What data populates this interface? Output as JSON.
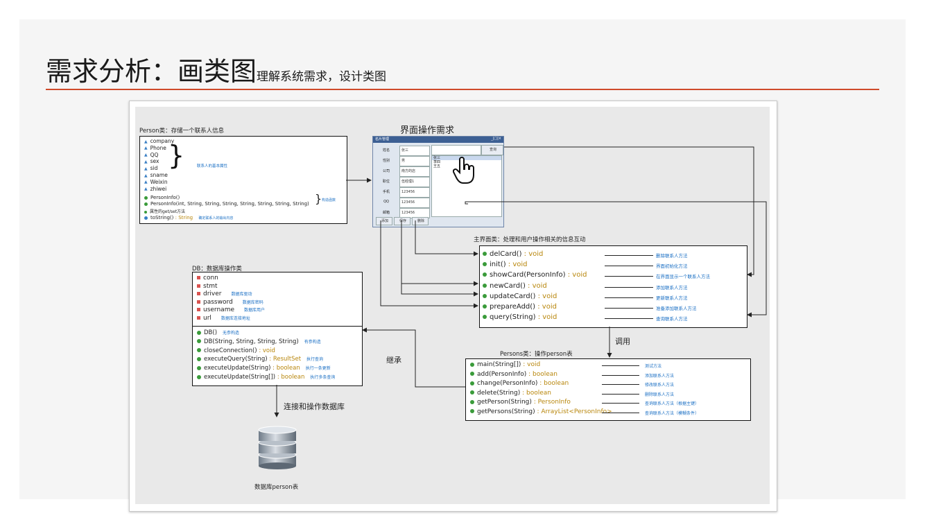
{
  "slide": {
    "title_main": "需求分析：画类图",
    "title_sub": "理解系统需求，设计类图"
  },
  "ui_section_title": "界面操作需求",
  "person_class": {
    "title": "Person类：存储一个联系人信息",
    "attributes": [
      "company",
      "Phone",
      "QQ",
      "sex",
      "sid",
      "sname",
      "Weixin",
      "zhiwei"
    ],
    "attr_note": "联系人的基本属性",
    "ctor1": "PersonInfo()",
    "ctor2": "PersonInfo(int, String, String, String, String, String, String, String)",
    "ctor_note": "构造函数",
    "getset": "属性的get/set方法",
    "tostring": "toString()",
    "tostring_type": " : String",
    "tostring_note": "确定联系人的输出内容"
  },
  "card_window": {
    "title": "名片管理",
    "window_buttons": "_|□|×",
    "field_labels": [
      "姓名",
      "性别",
      "公司",
      "职位",
      "手机",
      "QQ",
      "邮箱"
    ],
    "field_values": [
      "张三",
      "男",
      "南方的店",
      "伍经理1",
      "123456",
      "123456",
      "123456"
    ],
    "query_button": "查询",
    "list_items": [
      "张三",
      "李四",
      "王五"
    ],
    "buttons": [
      "添加",
      "保存",
      "删除"
    ]
  },
  "main_class": {
    "title": "主界面类：处理和用户操作相关的信息互动",
    "methods": [
      {
        "name": "delCard()",
        "type": " : void",
        "note": "删除联系人方法"
      },
      {
        "name": "init()",
        "type": " : void",
        "note": "界面初始化方法"
      },
      {
        "name": "showCard(PersonInfo)",
        "type": " : void",
        "note": "在界面显示一个联系人方法"
      },
      {
        "name": "newCard()",
        "type": " : void",
        "note": "添加联系人方法"
      },
      {
        "name": "updateCard()",
        "type": " : void",
        "note": "更新联系人方法"
      },
      {
        "name": "prepareAdd()",
        "type": " : void",
        "note": "准备添加联系人方法"
      },
      {
        "name": "query(String)",
        "type": " : void",
        "note": "查询联系人方法"
      }
    ]
  },
  "db_class": {
    "title": "DB：数据库操作类",
    "fields": [
      {
        "name": "conn",
        "note": ""
      },
      {
        "name": "stmt",
        "note": ""
      },
      {
        "name": "driver",
        "note": "数据库驱动"
      },
      {
        "name": "password",
        "note": "数据库密码"
      },
      {
        "name": "username",
        "note": "数据库用户"
      },
      {
        "name": "url",
        "note": "数据库连接地址"
      }
    ],
    "methods": [
      {
        "name": "DB()",
        "type": "",
        "note": "无参构造"
      },
      {
        "name": "DB(String, String, String, String)",
        "type": "",
        "note": "有参构造"
      },
      {
        "name": "closeConnection()",
        "type": " : void",
        "note": ""
      },
      {
        "name": "executeQuery(String)",
        "type": " : ResultSet",
        "note": "执行查询"
      },
      {
        "name": "executeUpdate(String)",
        "type": " : boolean",
        "note": "执行一条更新"
      },
      {
        "name": "executeUpdate(String[])",
        "type": " : boolean",
        "note": "执行多条查询"
      }
    ]
  },
  "persons_class": {
    "title": "Persons类：操作person表",
    "methods": [
      {
        "name": "main(String[])",
        "type": " : void",
        "note": "测试方法"
      },
      {
        "name": "add(PersonInfo)",
        "type": " : boolean",
        "note": "添加联系人方法"
      },
      {
        "name": "change(PersonInfo)",
        "type": " : boolean",
        "note": "修改联系人方法"
      },
      {
        "name": "delete(String)",
        "type": " : boolean",
        "note": "删除联系人方法"
      },
      {
        "name": "getPerson(String)",
        "type": " : PersonInfo",
        "note": "查询联系人方法（根据主键）"
      },
      {
        "name": "getPersons(String)",
        "type": " : ArrayList<PersonInfo>",
        "note": "查询联系人方法（模糊条件）"
      }
    ]
  },
  "labels": {
    "call": "调用",
    "inherit": "继承",
    "connect": "连接和操作数据库",
    "db_table": "数据库person表"
  },
  "colors": {
    "accent_rule": "#cf4a2a",
    "note_blue": "#1a6fc4",
    "type_gold": "#b8860b",
    "method_dot": "#3a9b3a"
  },
  "icons": {
    "pointer": "hand-pointer-icon",
    "database": "database-cylinder-icon"
  }
}
